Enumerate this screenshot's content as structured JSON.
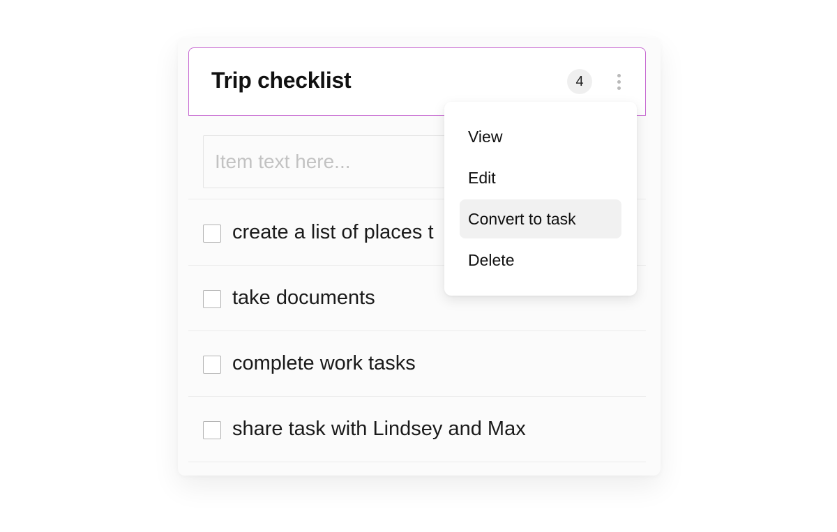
{
  "checklist": {
    "title": "Trip checklist",
    "count": "4",
    "more_icon": "vertical-ellipsis-icon",
    "accent_color": "#c76ad2"
  },
  "new_item": {
    "placeholder": "Item text here...",
    "value": ""
  },
  "items": [
    {
      "label": "create a list of places t",
      "checked": false
    },
    {
      "label": "take documents",
      "checked": false
    },
    {
      "label": "complete work tasks",
      "checked": false
    },
    {
      "label": "share task with Lindsey and Max",
      "checked": false
    }
  ],
  "menu": {
    "items": [
      {
        "label": "View"
      },
      {
        "label": "Edit"
      },
      {
        "label": "Convert to task",
        "highlighted": true
      },
      {
        "label": "Delete"
      }
    ]
  }
}
